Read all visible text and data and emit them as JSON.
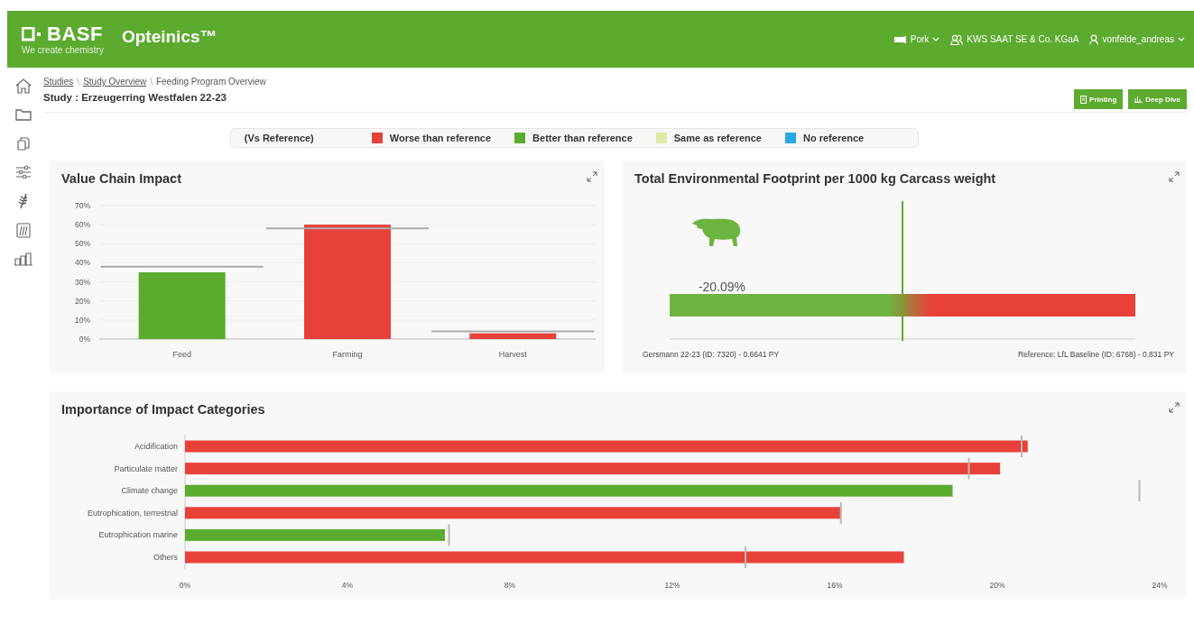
{
  "header": {
    "logo": {
      "wordmark": "BASF",
      "tagline": "We create chemistry"
    },
    "app_name": "Opteinics™",
    "nav": [
      {
        "kind": "species",
        "label": "Pork",
        "dropdown": true
      },
      {
        "kind": "company",
        "label": "KWS SAAT SE & Co. KGaA",
        "dropdown": false
      },
      {
        "kind": "user",
        "label": "vonfelde_andreas",
        "dropdown": true
      }
    ]
  },
  "sidebar": {
    "items": [
      {
        "kind": "home"
      },
      {
        "kind": "folder"
      },
      {
        "kind": "copy"
      },
      {
        "kind": "sliders"
      },
      {
        "kind": "wheat"
      },
      {
        "kind": "fields"
      },
      {
        "kind": "chart"
      }
    ]
  },
  "breadcrumb_separator": "\\",
  "breadcrumb": [
    {
      "label": "Studies",
      "link": true
    },
    {
      "label": "Study Overview",
      "link": true
    },
    {
      "label": "Feeding Program Overview",
      "link": false
    }
  ],
  "study_title": "Study : Erzeugerring Westfalen 22-23",
  "actions": [
    {
      "kind": "print",
      "label": "Printing"
    },
    {
      "kind": "chart",
      "label": "Deep Dive"
    }
  ],
  "legend": {
    "title": "(Vs Reference)",
    "items": [
      {
        "label": "Worse than reference",
        "color": "#e8413a"
      },
      {
        "label": "Better than reference",
        "color": "#5aab2e"
      },
      {
        "label": "Same as reference",
        "color": "#dfe9a8"
      },
      {
        "label": "No reference",
        "color": "#2aa6e0"
      }
    ]
  },
  "value_chain": {
    "title": "Value Chain Impact",
    "chart_data": {
      "type": "bar",
      "orientation": "vertical",
      "grid": true,
      "categories": [
        "Feed",
        "Farming",
        "Harvest"
      ],
      "series": [
        {
          "colors": [
            "#5aab2e",
            "#e8413a",
            "#e8413a"
          ],
          "values": [
            35,
            60,
            3
          ]
        }
      ],
      "ref_lines": [
        {
          "axis": "y",
          "value": 38,
          "color": "#aaaaaa"
        },
        {
          "axis": "y",
          "value": 58,
          "color": "#aaaaaa"
        },
        {
          "axis": "y",
          "value": 4,
          "color": "#aaaaaa"
        }
      ],
      "ylim": [
        0,
        70
      ],
      "yticks": [
        {
          "value": 0,
          "label": "0%"
        },
        {
          "value": 10,
          "label": "10%"
        },
        {
          "value": 20,
          "label": "20%"
        },
        {
          "value": 30,
          "label": "30%"
        },
        {
          "value": 40,
          "label": "40%"
        },
        {
          "value": 50,
          "label": "50%"
        },
        {
          "value": 60,
          "label": "60%"
        },
        {
          "value": 70,
          "label": "70%"
        }
      ]
    }
  },
  "footprint": {
    "title": "Total Environmental Footprint per 1000 kg Carcass weight",
    "change": "-20.09%",
    "study_label": "Gersmann 22-23 (ID: 7320) - 0.6641 PY",
    "reference_label": "Reference: LfL Baseline (ID: 6768) - 0.831 PY"
  },
  "impact": {
    "title": "Importance of Impact Categories",
    "chart_data": {
      "type": "bar",
      "orientation": "horizontal",
      "categories": [
        "Acidification",
        "Particulate matter",
        "Climate change",
        "Eutrophication, terrestrial",
        "Eutrophication marine",
        "Others"
      ],
      "series": [
        {
          "colors": [
            "#e8413a",
            "#e8413a",
            "#5aab2e",
            "#e8413a",
            "#5aab2e",
            "#e8413a"
          ],
          "values": [
            20.75,
            20.07,
            18.9,
            16.15,
            6.4,
            17.7
          ]
        }
      ],
      "ref_lines": [
        {
          "axis": "x",
          "value": 20.6,
          "color": "#b8b8b8"
        },
        {
          "axis": "x",
          "value": 19.3,
          "color": "#b8b8b8"
        },
        {
          "axis": "x",
          "value": 23.5,
          "color": "#b8b8b8"
        },
        {
          "axis": "x",
          "value": 16.15,
          "color": "#b8b8b8"
        },
        {
          "axis": "x",
          "value": 6.5,
          "color": "#b8b8b8"
        },
        {
          "axis": "x",
          "value": 13.8,
          "color": "#b8b8b8"
        }
      ],
      "xlim": [
        0,
        24
      ],
      "xticks": [
        {
          "value": 0,
          "label": "0%"
        },
        {
          "value": 4,
          "label": "4%"
        },
        {
          "value": 8,
          "label": "8%"
        },
        {
          "value": 12,
          "label": "12%"
        },
        {
          "value": 16,
          "label": "16%"
        },
        {
          "value": 20,
          "label": "20%"
        },
        {
          "value": 24,
          "label": "24%"
        }
      ]
    }
  }
}
